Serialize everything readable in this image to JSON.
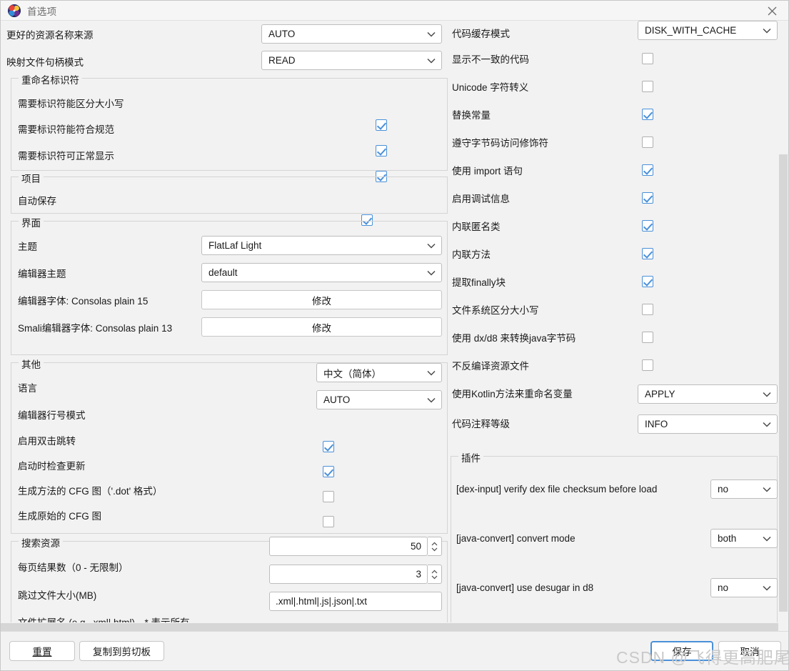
{
  "window": {
    "title": "首选项",
    "icon": "jadx-logo-icon",
    "close_icon": "close-icon"
  },
  "left_column": {
    "top_rows": [
      {
        "label": "更好的资源名称来源",
        "control": "combo",
        "value": "AUTO"
      },
      {
        "label": "映射文件句柄模式",
        "control": "combo",
        "value": "READ"
      }
    ],
    "groups": [
      {
        "title": "重命名标识符",
        "rows": [
          {
            "label": "需要标识符能区分大小写",
            "control": "checkbox",
            "checked": true
          },
          {
            "label": "需要标识符能符合规范",
            "control": "checkbox",
            "checked": true
          },
          {
            "label": "需要标识符可正常显示",
            "control": "checkbox",
            "checked": true
          }
        ]
      },
      {
        "title": "项目",
        "rows": [
          {
            "label": "自动保存",
            "control": "checkbox",
            "checked": true
          }
        ]
      },
      {
        "title": "界面",
        "rows": [
          {
            "label": "主题",
            "control": "combo",
            "value": "FlatLaf Light"
          },
          {
            "label": "编辑器主题",
            "control": "combo",
            "value": "default"
          },
          {
            "label": "编辑器字体: Consolas plain 15",
            "control": "button",
            "value": "修改"
          },
          {
            "label": "Smali编辑器字体: Consolas plain 13",
            "control": "button",
            "value": "修改"
          }
        ]
      },
      {
        "title": "其他",
        "rows": [
          {
            "label": "语言",
            "control": "combo",
            "value": "中文（简体）"
          },
          {
            "label": "编辑器行号模式",
            "control": "combo",
            "value": "AUTO"
          },
          {
            "label": "启用双击跳转",
            "control": "checkbox",
            "checked": true
          },
          {
            "label": "启动时检查更新",
            "control": "checkbox",
            "checked": true
          },
          {
            "label": "生成方法的 CFG 图（'.dot' 格式）",
            "control": "checkbox",
            "checked": false
          },
          {
            "label": "生成原始的 CFG 图",
            "control": "checkbox",
            "checked": false
          }
        ]
      },
      {
        "title": "搜索资源",
        "rows": [
          {
            "label": "每页结果数（0 - 无限制）",
            "control": "spinner",
            "value": "50"
          },
          {
            "label": "跳过文件大小(MB)",
            "control": "spinner",
            "value": "3"
          },
          {
            "label": "文件扩展名 (e.g. .xml|.html)，* 表示所有",
            "control": "text",
            "value": ".xml|.html|.js|.json|.txt"
          }
        ]
      }
    ]
  },
  "right_column": {
    "rows": [
      {
        "label": "代码缓存模式",
        "control": "combo",
        "value": "DISK_WITH_CACHE"
      },
      {
        "label": "显示不一致的代码",
        "control": "checkbox",
        "checked": false
      },
      {
        "label": "Unicode 字符转义",
        "control": "checkbox",
        "checked": false
      },
      {
        "label": "替换常量",
        "control": "checkbox",
        "checked": true
      },
      {
        "label": "遵守字节码访问修饰符",
        "control": "checkbox",
        "checked": false
      },
      {
        "label": "使用 import 语句",
        "control": "checkbox",
        "checked": true
      },
      {
        "label": "启用调试信息",
        "control": "checkbox",
        "checked": true
      },
      {
        "label": "内联匿名类",
        "control": "checkbox",
        "checked": true
      },
      {
        "label": "内联方法",
        "control": "checkbox",
        "checked": true
      },
      {
        "label": "提取finally块",
        "control": "checkbox",
        "checked": true
      },
      {
        "label": "文件系统区分大小写",
        "control": "checkbox",
        "checked": false
      },
      {
        "label": "使用 dx/d8 来转换java字节码",
        "control": "checkbox",
        "checked": false
      },
      {
        "label": "不反编译资源文件",
        "control": "checkbox",
        "checked": false
      },
      {
        "label": "使用Kotlin方法来重命名变量",
        "control": "combo",
        "value": "APPLY"
      },
      {
        "label": "代码注释等级",
        "control": "combo",
        "value": "INFO"
      }
    ],
    "plugins_group": {
      "title": "插件",
      "rows": [
        {
          "label": "[dex-input]  verify dex file checksum before load",
          "control": "combo",
          "value": "no"
        },
        {
          "label": "[java-convert]  convert mode",
          "control": "combo",
          "value": "both"
        },
        {
          "label": "[java-convert]  use desugar in d8",
          "control": "combo",
          "value": "no"
        }
      ]
    }
  },
  "footer": {
    "reset_label": "重置",
    "copy_label": "复制到剪切板",
    "save_label": "保存",
    "cancel_label": "取消"
  },
  "watermark": {
    "text": "CSDN @飞得更高肥尾沙鼠"
  },
  "colors": {
    "accent": "#4a90d9",
    "background": "#f2f2f2",
    "field_background": "#ffffff",
    "border": "#bdbdbd",
    "group_border": "#d4d4d4",
    "title_text": "#6b6b6b",
    "scrollbar_thumb": "#d6d6d6",
    "watermark": "#c9c9c9"
  }
}
